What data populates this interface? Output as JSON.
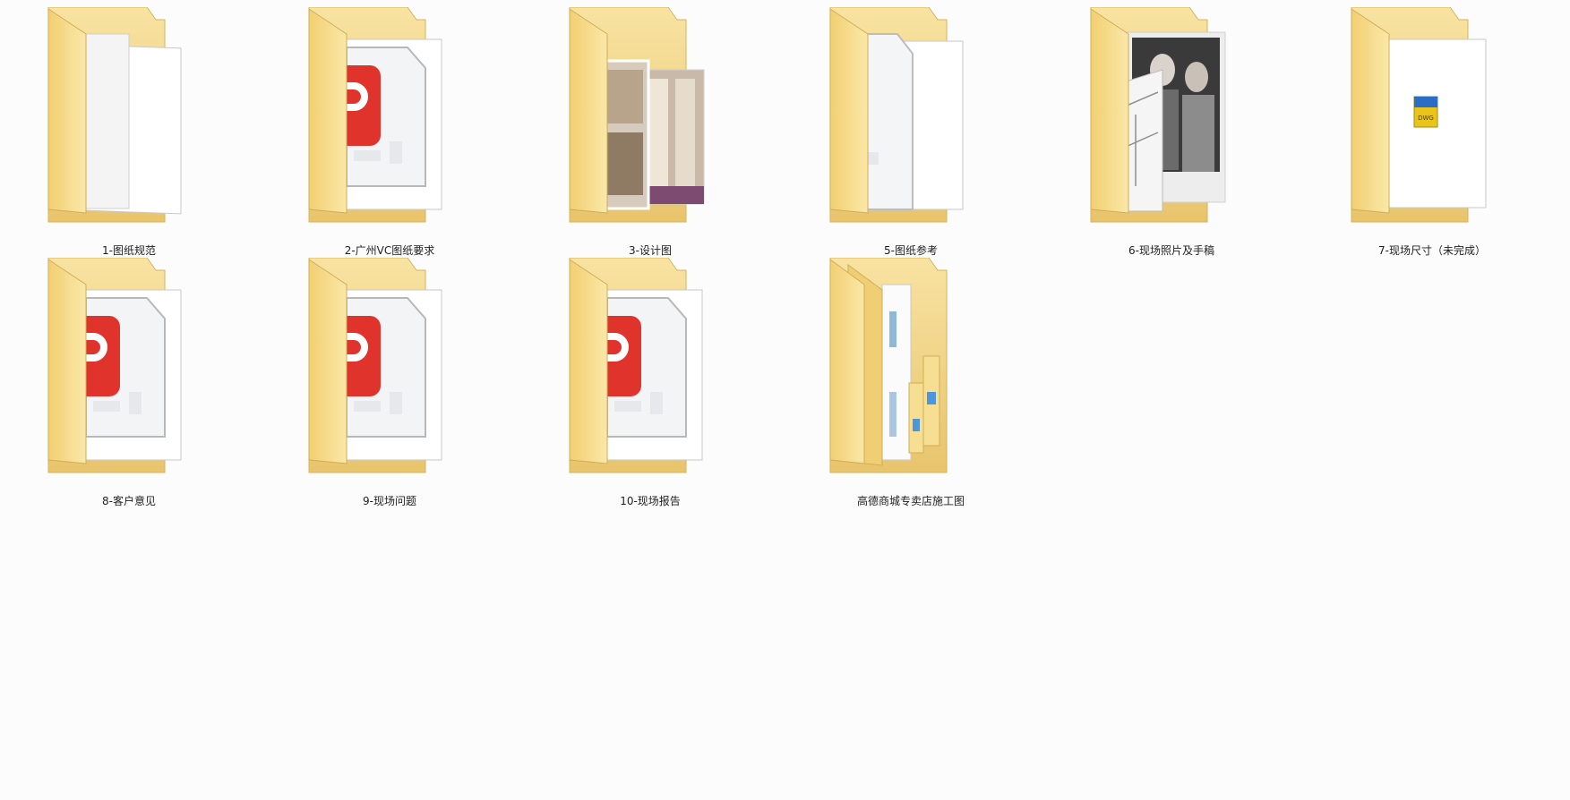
{
  "folders": [
    {
      "label": "1-图纸规范",
      "preview": "blank-dwg"
    },
    {
      "label": "2-广州VC图纸要求",
      "preview": "pdf"
    },
    {
      "label": "3-设计图",
      "preview": "photo-interior"
    },
    {
      "label": "5-图纸参考",
      "preview": "pdf-partial"
    },
    {
      "label": "6-现场照片及手稿",
      "preview": "photo-people"
    },
    {
      "label": "7-现场尺寸（未完成）",
      "preview": "dwg"
    },
    {
      "label": "8-客户意见",
      "preview": "pdf"
    },
    {
      "label": "9-现场问题",
      "preview": "pdf"
    },
    {
      "label": "10-现场报告",
      "preview": "pdf"
    },
    {
      "label": "高德商城专卖店施工图",
      "preview": "docs-stack"
    }
  ],
  "colors": {
    "folder_back": "#f3d788",
    "folder_front": "#f6df93",
    "pdf_red": "#e0332c",
    "dwg_yellow": "#e9c51c",
    "dwg_blue": "#2b6cc4"
  },
  "icons": {
    "folder": "folder-icon",
    "pdf": "pdf-icon",
    "dwg": "dwg-file-icon"
  },
  "dwg_badge": "DWG"
}
